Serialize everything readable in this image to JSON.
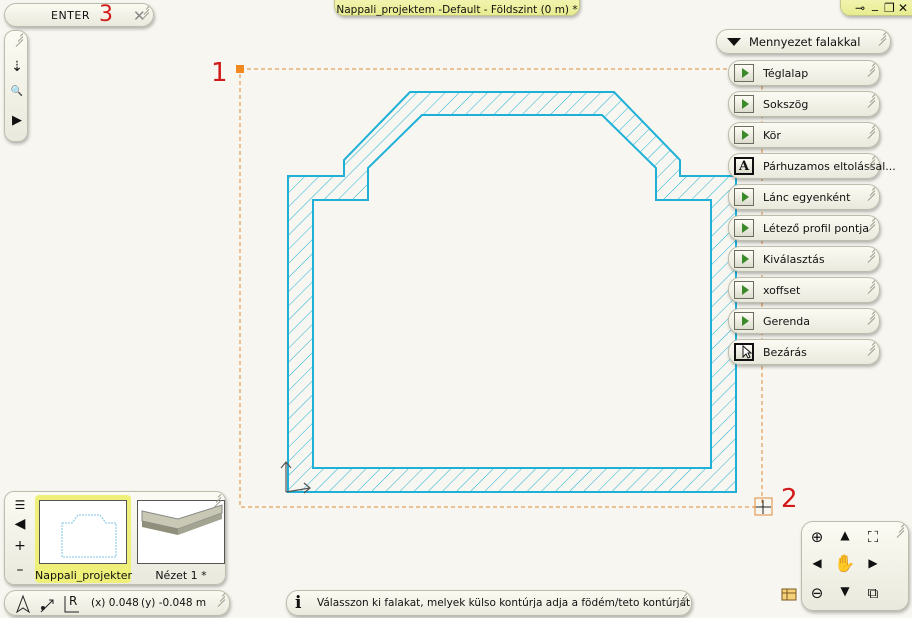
{
  "enter": {
    "label": "ENTER",
    "marker": "3",
    "close": "✕"
  },
  "title": "Nappali_projektem -Default - Földszint (0 m) *",
  "window_controls": {
    "pin": "⊸",
    "minimize": "_",
    "restore": "❐",
    "close": "✕"
  },
  "left_toolbar": {
    "pointer": "⇣",
    "zoom": "🔍",
    "play": "▶"
  },
  "menu": {
    "header": "Mennyezet falakkal",
    "items": [
      {
        "label": "Téglalap",
        "icon": "play-icon"
      },
      {
        "label": "Sokszög",
        "icon": "play-icon"
      },
      {
        "label": "Kör",
        "icon": "play-icon"
      },
      {
        "label": "Párhuzamos eltolással...",
        "icon": "text-a-icon",
        "glyph": "A"
      },
      {
        "label": "Lánc egyenként",
        "icon": "play-icon"
      },
      {
        "label": "Létező profil pontja",
        "icon": "play-icon"
      },
      {
        "label": "Kiválasztás",
        "icon": "play-icon"
      },
      {
        "label": "xoffset",
        "icon": "play-icon"
      },
      {
        "label": "Gerenda",
        "icon": "play-icon"
      },
      {
        "label": "Bezárás",
        "icon": "cursor-icon"
      }
    ]
  },
  "markers": {
    "first": "1",
    "second": "2"
  },
  "views": {
    "side": {
      "list": "☰",
      "prev": "◀",
      "add": "+",
      "remove": "–"
    },
    "thumbs": [
      {
        "label": "Nappali_projekter"
      },
      {
        "label": "Nézet 1 *"
      }
    ]
  },
  "coords": {
    "x": "(x) 0.048",
    "y": "(y) -0.048 m"
  },
  "status": {
    "info": "i",
    "message": "Válasszon ki falakat, melyek külso kontúrja adja a födém/teto kontúrját"
  },
  "colors": {
    "wall": "#1fb0d8",
    "marker": "#d21c1c",
    "selection": "#e08a3a"
  }
}
